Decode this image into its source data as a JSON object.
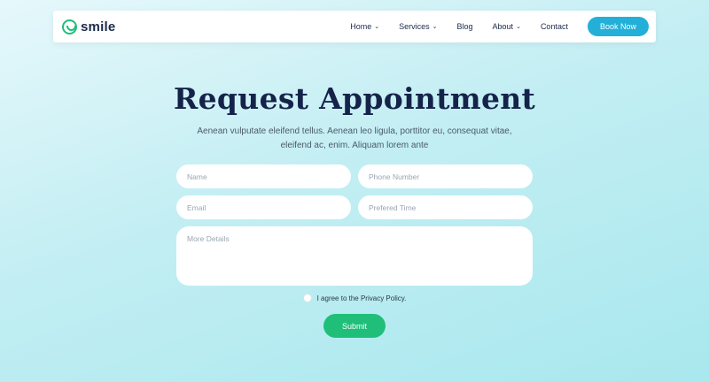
{
  "header": {
    "logo_text": "smile",
    "nav": [
      {
        "label": "Home",
        "has_dropdown": true
      },
      {
        "label": "Services",
        "has_dropdown": true
      },
      {
        "label": "Blog",
        "has_dropdown": false
      },
      {
        "label": "About",
        "has_dropdown": true
      },
      {
        "label": "Contact",
        "has_dropdown": false
      }
    ],
    "cta_label": "Book Now"
  },
  "hero": {
    "title": "Request Appointment",
    "subtitle_line1": "Aenean vulputate eleifend tellus. Aenean leo ligula, porttitor eu, consequat vitae,",
    "subtitle_line2": "eleifend ac, enim. Aliquam lorem ante"
  },
  "form": {
    "name_placeholder": "Name",
    "phone_placeholder": "Phone Number",
    "email_placeholder": "Email",
    "time_placeholder": "Prefered Time",
    "details_placeholder": "More Details",
    "agree_label": "I agree to the Privacy Policy.",
    "submit_label": "Submit"
  },
  "colors": {
    "brand_green": "#1fbf7a",
    "accent_blue": "#23b0d8",
    "heading_navy": "#15234a"
  }
}
